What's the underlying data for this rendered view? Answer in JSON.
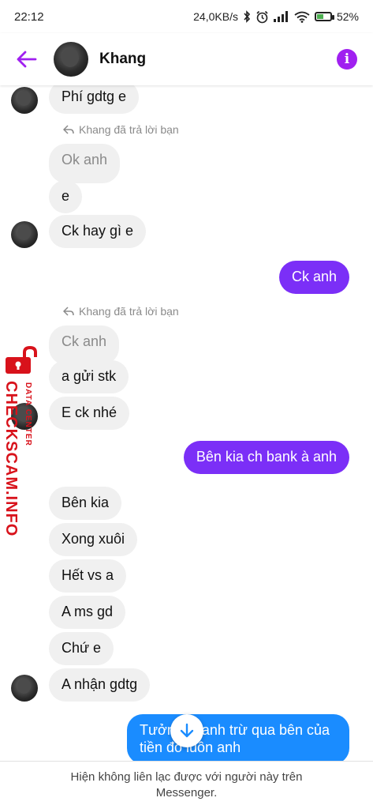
{
  "status_bar": {
    "time": "22:12",
    "network_speed": "24,0KB/s",
    "battery_percent": "52%",
    "battery_level": 0.52,
    "icons": [
      "bluetooth-icon",
      "alarm-icon",
      "signal-icon",
      "wifi-icon",
      "battery-icon"
    ]
  },
  "header": {
    "contact_name": "Khang",
    "accent_color": "#a020f0"
  },
  "messages": {
    "m1": "Phí gdtg e",
    "reply_note_1": "Khang đã trả lời bạn",
    "m2_quoted": "Ok anh",
    "m3": "e",
    "m4": "Ck hay gì e",
    "m5_out": "Ck anh",
    "reply_note_2": "Khang đã trả lời bạn",
    "m6_quoted": "Ck anh",
    "m7": "a gửi stk",
    "m8": "E ck nhé",
    "m9_out": "Bên kia ch bank à anh",
    "m10": "Bên kia",
    "m11": "Xong xuôi",
    "m12": "Hết vs a",
    "m13": "A ms gd",
    "m14": "Chứ e",
    "m15": "A nhận gdtg",
    "m16_out_line1": "Tưởng là anh trừ qua bên của",
    "m16_out_line2": "tiền đó luôn anh"
  },
  "colors": {
    "outgoing_purple": "#7b2ff7",
    "outgoing_blue": "#1a8cff",
    "incoming_bg": "#f0f0f0",
    "watermark_red": "#d8121b"
  },
  "watermark": {
    "main": "CHECKSCAM.INFO",
    "sub": "DATA CENTER"
  },
  "footer": {
    "line1": "Hiện không liên lạc được với người này trên",
    "line2": "Messenger."
  }
}
